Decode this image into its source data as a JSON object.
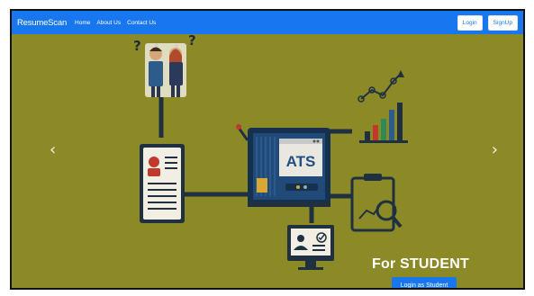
{
  "navbar": {
    "brand": "ResumeScan",
    "links": [
      "Home",
      "About Us",
      "Contact Us"
    ],
    "login_label": "Login",
    "signup_label": "SignUp"
  },
  "hero": {
    "ats_label": "ATS",
    "question_marks": [
      "?",
      "?"
    ],
    "caption": "For STUDENT",
    "cta_label": "Login as Student",
    "prev_arrow": "‹",
    "next_arrow": "›"
  },
  "colors": {
    "navbar": "#1877ee",
    "background": "#8c8a27",
    "button": "#1877ee"
  },
  "icons": [
    "people-icon",
    "resume-icon",
    "ats-machine-icon",
    "growth-chart-icon",
    "analysis-clipboard-icon",
    "monitor-user-icon"
  ]
}
